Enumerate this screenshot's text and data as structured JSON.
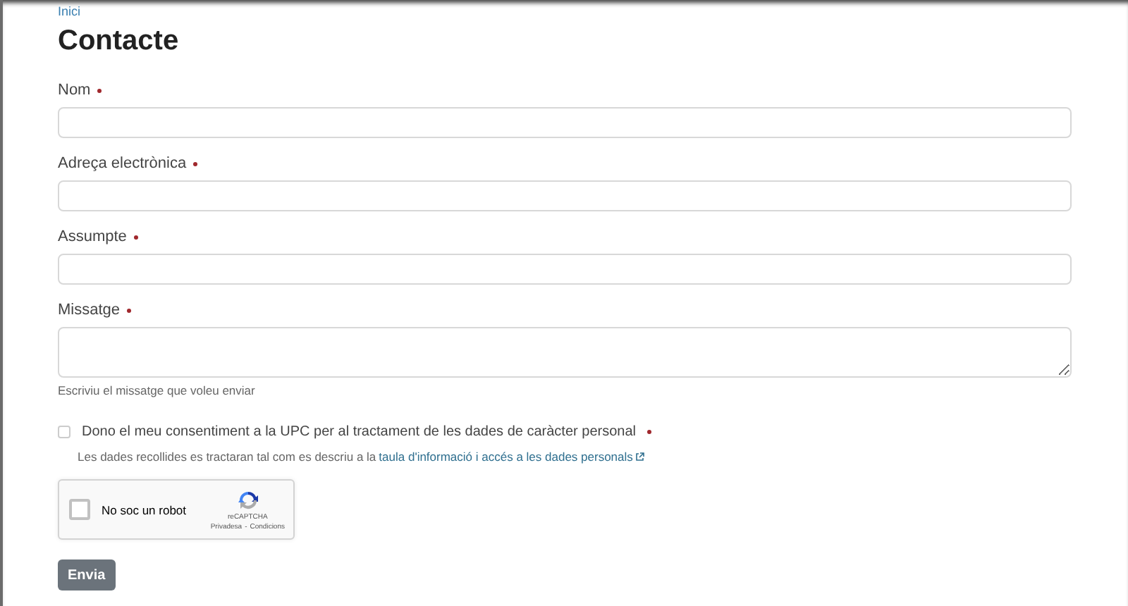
{
  "breadcrumb": {
    "label": "Inici"
  },
  "title": "Contacte",
  "fields": [
    {
      "label": "Nom",
      "required": true,
      "kind": "text"
    },
    {
      "label": "Adreça electrònica",
      "required": true,
      "kind": "text"
    },
    {
      "label": "Assumpte",
      "required": true,
      "kind": "text"
    },
    {
      "label": "Missatge",
      "required": true,
      "kind": "textarea",
      "help": "Escriviu el missatge que voleu enviar"
    }
  ],
  "consent": {
    "label": "Dono el meu consentiment a la UPC per al tractament de les dades de caràcter personal",
    "required": true,
    "checked": false,
    "info": "Les dades recollides es tractaran tal com es descriu a la ",
    "link": "taula d'informació i accés a les dades personals"
  },
  "captcha": {
    "label": "No soc un robot",
    "checked": false,
    "brand": "reCAPTCHA",
    "privacy": "Privadesa",
    "separator": "-",
    "terms": "Condicions"
  },
  "submit": "Envia"
}
